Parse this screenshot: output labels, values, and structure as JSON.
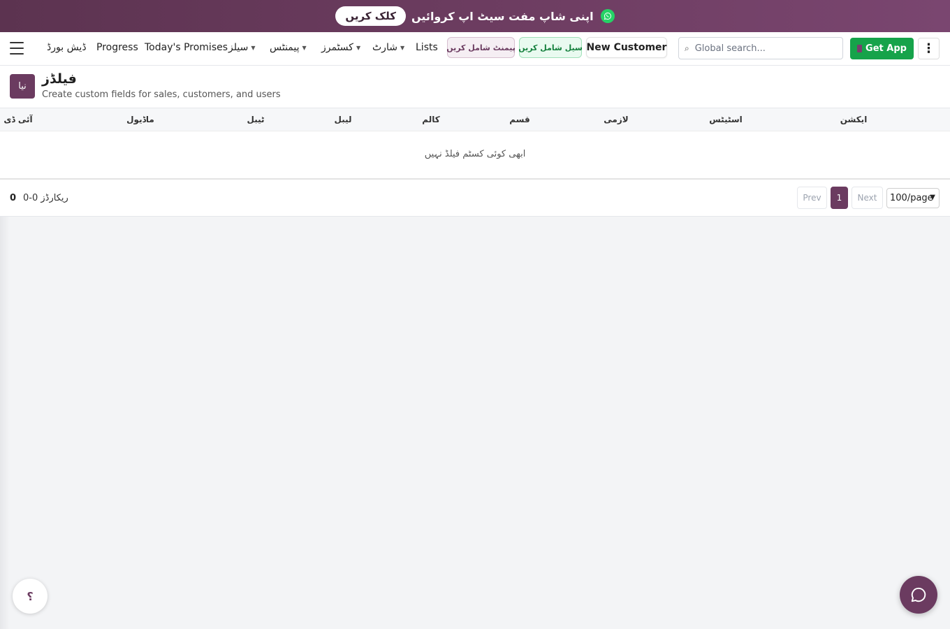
{
  "banner": {
    "text": "اپنی شاپ مفت سیٹ اپ کروائیں",
    "button": "کلک کریں",
    "icon": "whatsapp-icon",
    "icon_color": "#25d366"
  },
  "nav": {
    "items": [
      {
        "label": "ڈیش بورڈ",
        "dropdown": false
      },
      {
        "label": "Progress",
        "dropdown": false
      },
      {
        "label": "Today's Promises",
        "dropdown": false
      },
      {
        "label": "سیلز",
        "dropdown": true
      },
      {
        "label": "پیمنٹس",
        "dropdown": true
      },
      {
        "label": "کسٹمرز",
        "dropdown": true
      },
      {
        "label": "شارٹ",
        "dropdown": true
      },
      {
        "label": "Lists",
        "dropdown": false
      }
    ],
    "add_payment": "پیمنٹ شامل کریں",
    "add_sale": "سیل شامل کریں",
    "new_customer": "New Customer",
    "search_placeholder": "Global search...",
    "get_app": "Get App",
    "more": "⋮"
  },
  "header": {
    "new_button": "نیا",
    "title": "فیلڈز",
    "subtitle": "Create custom fields for sales, customers, and users"
  },
  "table": {
    "columns": [
      "آئی ڈی",
      "ماڈیول",
      "ٹیبل",
      "لیبل",
      "کالم",
      "قسم",
      "لازمی",
      "اسٹیٹس",
      "ایکشن"
    ],
    "empty_message": "ابھی کوئی کسٹم فیلڈ نہیں"
  },
  "footer": {
    "count": "0",
    "range": "ریکارڈز 0-0",
    "prev": "Prev",
    "current_page": "1",
    "next": "Next",
    "per_page": "100/page"
  },
  "floating": {
    "help": "؟",
    "chat_icon": "chat-bubble-icon"
  },
  "colors": {
    "brand": "#6b3b60",
    "success": "#16a34a",
    "banner": "#6f3e63"
  }
}
